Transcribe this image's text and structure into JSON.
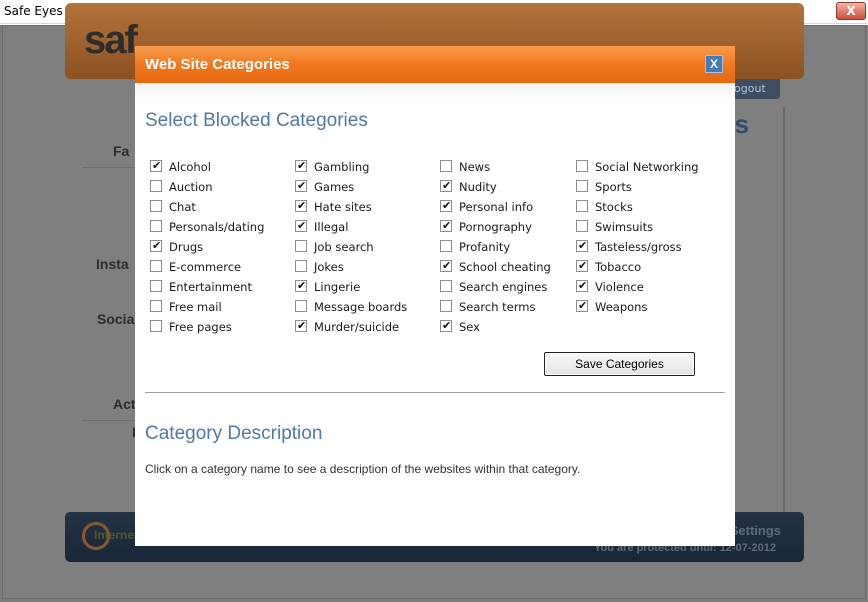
{
  "window": {
    "title": "Safe Eyes Filter Administrator",
    "close_glyph": "X"
  },
  "background": {
    "logo_text": "saf",
    "logout_text": "ogout",
    "heading_fragment": "es",
    "side_labels": [
      "Fa",
      "Insta",
      "Socia",
      "Act",
      "I"
    ],
    "footer_logo_text": "InternetSafety.com",
    "advanced_settings": "Advanced Settings",
    "protected_until": "You are protected until: 12-07-2012"
  },
  "modal": {
    "title": "Web Site Categories",
    "close_glyph": "X",
    "select_heading": "Select Blocked Categories",
    "save_button": "Save Categories",
    "description_heading": "Category Description",
    "description_text": "Click on a category name to see a description of the websites within that category."
  },
  "categories": [
    {
      "label": "Alcohol",
      "checked": true
    },
    {
      "label": "Auction",
      "checked": false
    },
    {
      "label": "Chat",
      "checked": false
    },
    {
      "label": "Personals/dating",
      "checked": false
    },
    {
      "label": "Drugs",
      "checked": true
    },
    {
      "label": "E-commerce",
      "checked": false
    },
    {
      "label": "Entertainment",
      "checked": false
    },
    {
      "label": "Free mail",
      "checked": false
    },
    {
      "label": "Free pages",
      "checked": false
    },
    {
      "label": "Gambling",
      "checked": true
    },
    {
      "label": "Games",
      "checked": true
    },
    {
      "label": "Hate sites",
      "checked": true
    },
    {
      "label": "Illegal",
      "checked": true
    },
    {
      "label": "Job search",
      "checked": false
    },
    {
      "label": "Jokes",
      "checked": false
    },
    {
      "label": "Lingerie",
      "checked": true
    },
    {
      "label": "Message boards",
      "checked": false
    },
    {
      "label": "Murder/suicide",
      "checked": true
    },
    {
      "label": "News",
      "checked": false
    },
    {
      "label": "Nudity",
      "checked": true
    },
    {
      "label": "Personal info",
      "checked": true
    },
    {
      "label": "Pornography",
      "checked": true
    },
    {
      "label": "Profanity",
      "checked": false
    },
    {
      "label": "School cheating",
      "checked": true
    },
    {
      "label": "Search engines",
      "checked": false
    },
    {
      "label": "Search terms",
      "checked": false
    },
    {
      "label": "Sex",
      "checked": true
    },
    {
      "label": "Social Networking",
      "checked": false
    },
    {
      "label": "Sports",
      "checked": false
    },
    {
      "label": "Stocks",
      "checked": false
    },
    {
      "label": "Swimsuits",
      "checked": false
    },
    {
      "label": "Tasteless/gross",
      "checked": true
    },
    {
      "label": "Tobacco",
      "checked": true
    },
    {
      "label": "Violence",
      "checked": true
    },
    {
      "label": "Weapons",
      "checked": true
    }
  ],
  "colors": {
    "modal_header": "#f07820",
    "heading_blue": "#4f7aa5",
    "close_blue": "#4579b8"
  }
}
